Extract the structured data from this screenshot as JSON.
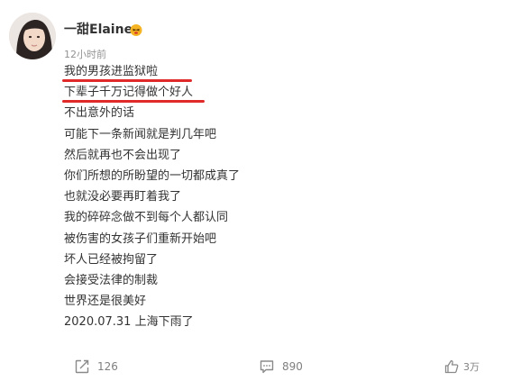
{
  "post": {
    "user_name": "一甜Elaine",
    "badge_icon": "emoji-badge-icon",
    "timestamp": "12小时前",
    "lines": [
      "我的男孩进监狱啦",
      "下辈子千万记得做个好人",
      "不出意外的话",
      "可能下一条新闻就是判几年吧",
      "然后就再也不会出现了",
      "你们所想的所盼望的一切都成真了",
      "也就没必要再盯着我了",
      "我的碎碎念做不到每个人都认同",
      "被伤害的女孩子们重新开始吧",
      "坏人已经被拘留了",
      "会接受法律的制裁",
      "世界还是很美好",
      "2020.07.31 上海下雨了"
    ],
    "highlight_color": "#e02a2a"
  },
  "footer": {
    "repost": {
      "icon": "repost-icon",
      "count": "126"
    },
    "comment": {
      "icon": "comment-icon",
      "count": "890"
    },
    "like": {
      "icon": "thumbs-up-icon",
      "count": "3万"
    }
  }
}
